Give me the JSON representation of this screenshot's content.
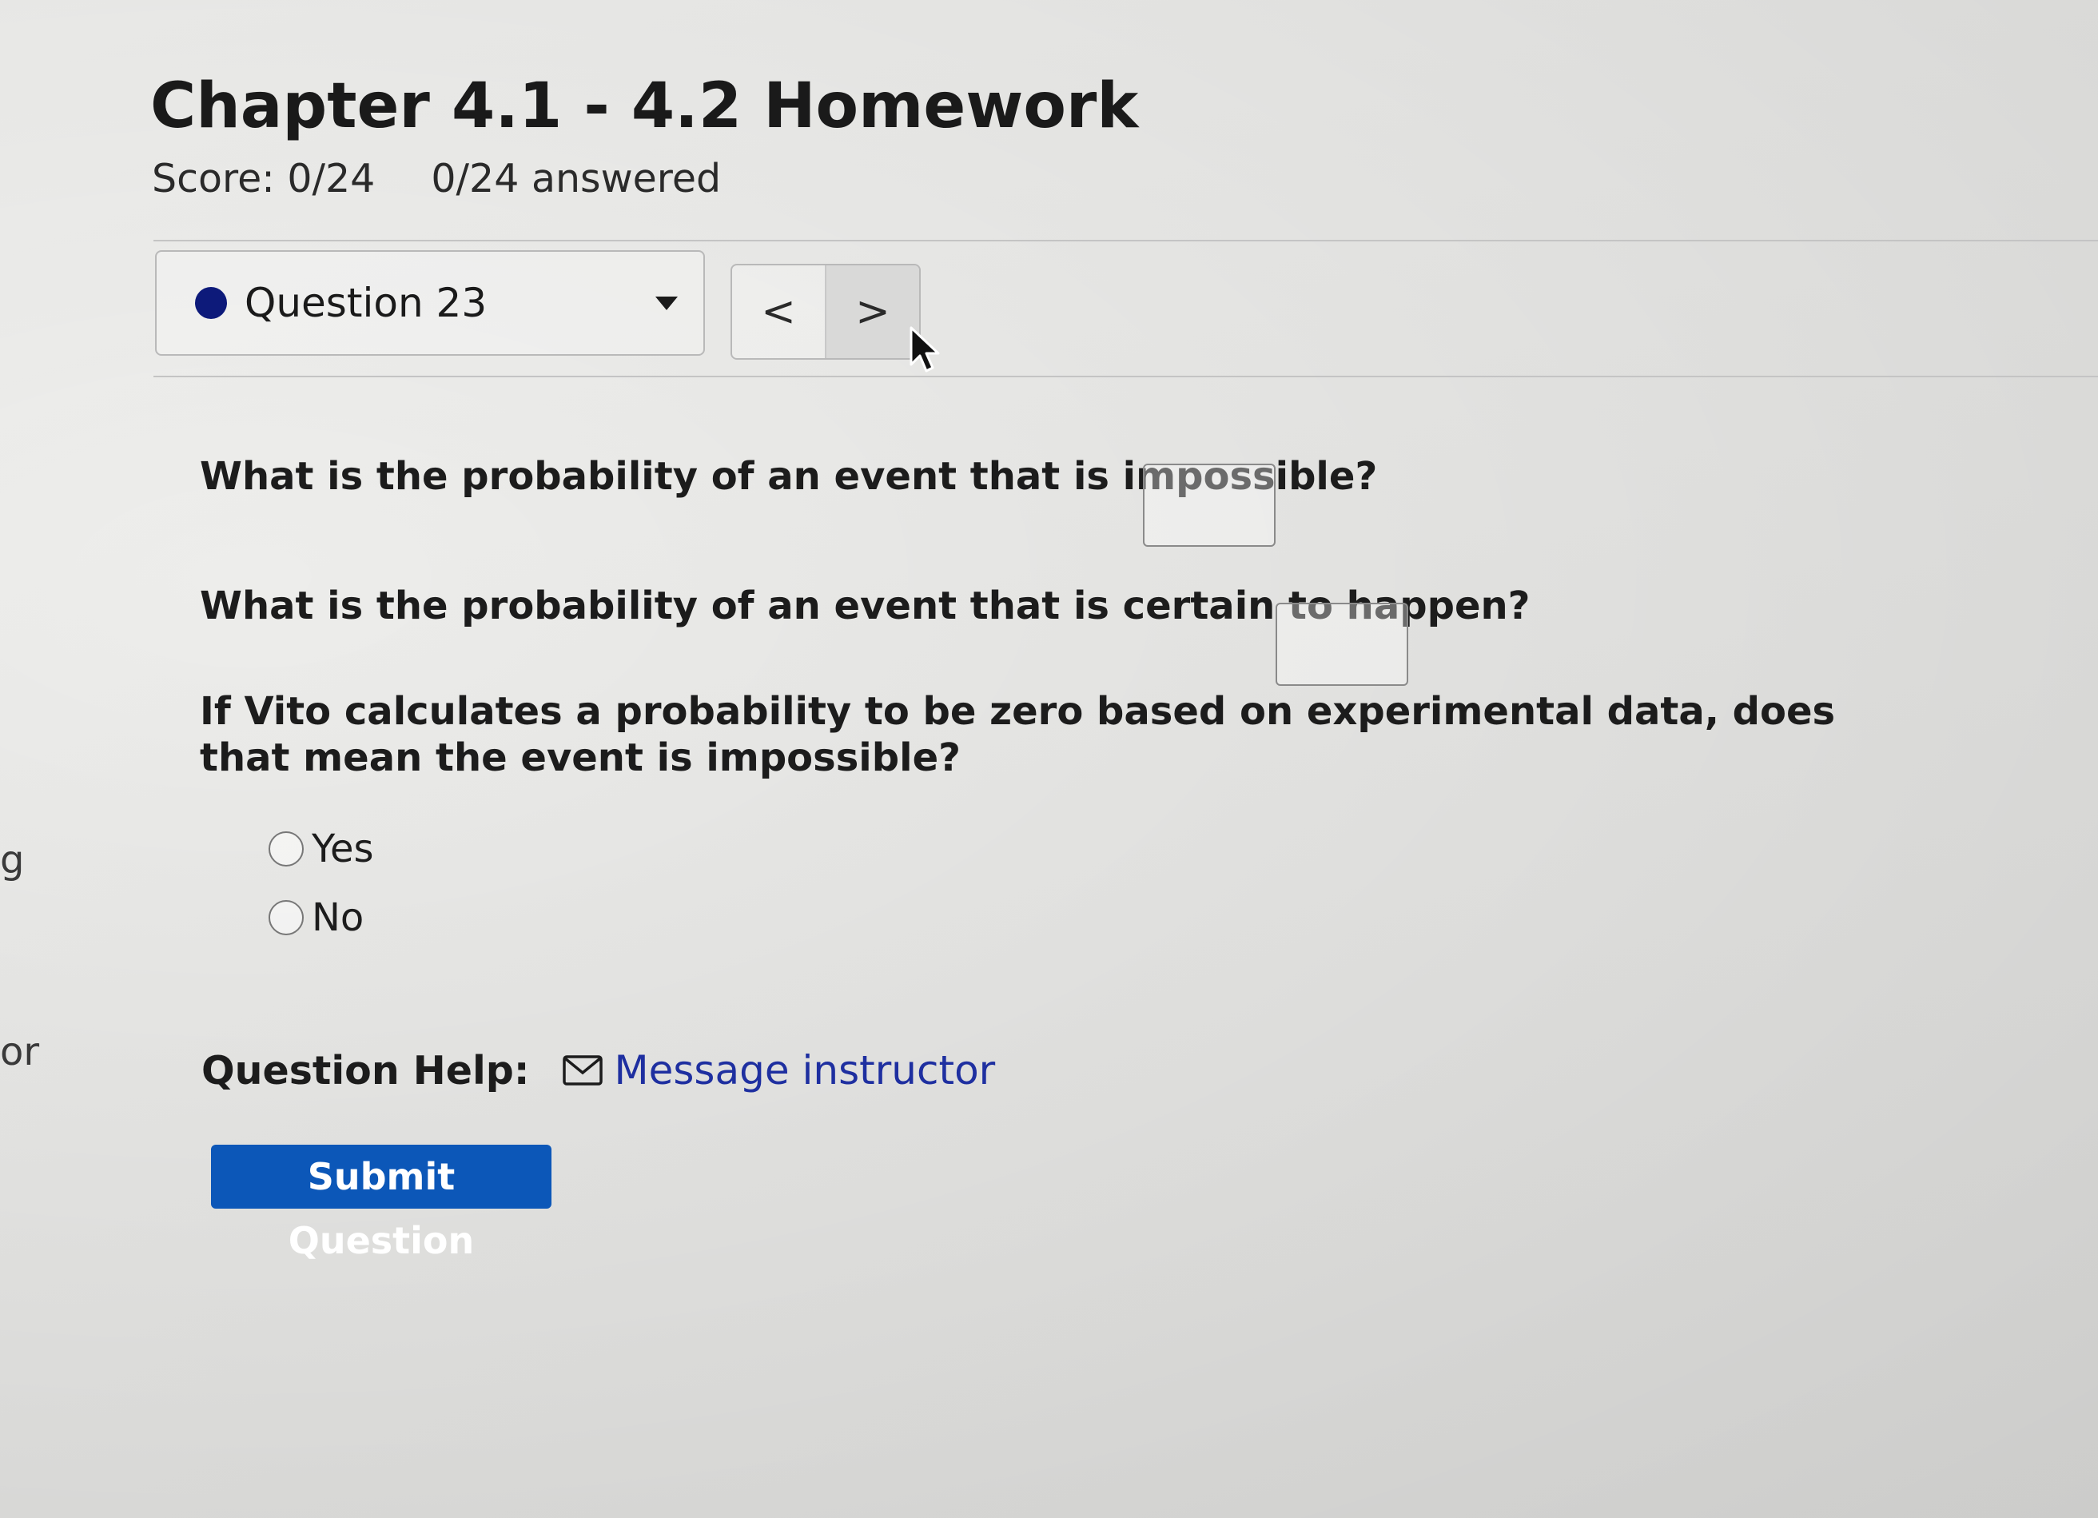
{
  "side_fragments": {
    "top": "g",
    "bottom": "or"
  },
  "header": {
    "title": "Chapter 4.1 - 4.2 Homework",
    "score": "Score: 0/24",
    "answered": "0/24 answered"
  },
  "question_nav": {
    "selected": "Question 23",
    "status_color": "#0d1a7a",
    "prev_glyph": "<",
    "next_glyph": ">"
  },
  "questions": [
    {
      "text": "What is the probability of an event that is impossible?",
      "answer": ""
    },
    {
      "text": "What is the probability of an event that is certain to happen?",
      "answer": ""
    },
    {
      "text": "If Vito calculates a probability to be zero based on experimental data, does that mean the event is impossible?"
    }
  ],
  "options": [
    "Yes",
    "No"
  ],
  "help": {
    "label": "Question Help:",
    "icon": "mail-icon",
    "link": "Message instructor"
  },
  "submit": {
    "label": "Submit Question",
    "color": "#0c57b8"
  }
}
